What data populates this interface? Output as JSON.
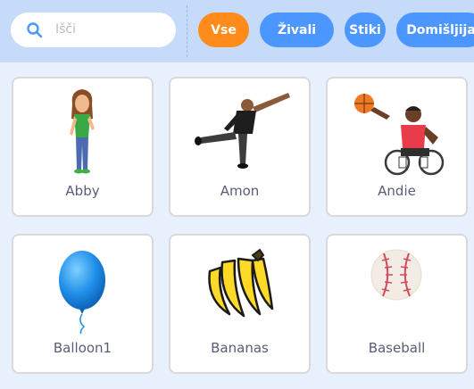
{
  "search": {
    "placeholder": "Išči",
    "icon": "search-icon"
  },
  "tags": [
    "Vse",
    "Živali",
    "Stiki",
    "Domišljija"
  ],
  "colors": {
    "topbar": "#c6dbfa",
    "background": "#e8f0fd",
    "active_tag": "#ff8c1a",
    "tag": "#4c97ff",
    "label": "#575e75"
  },
  "sprites": [
    {
      "name": "Abby"
    },
    {
      "name": "Amon"
    },
    {
      "name": "Andie"
    },
    {
      "name": "Balloon1"
    },
    {
      "name": "Bananas"
    },
    {
      "name": "Baseball"
    }
  ]
}
